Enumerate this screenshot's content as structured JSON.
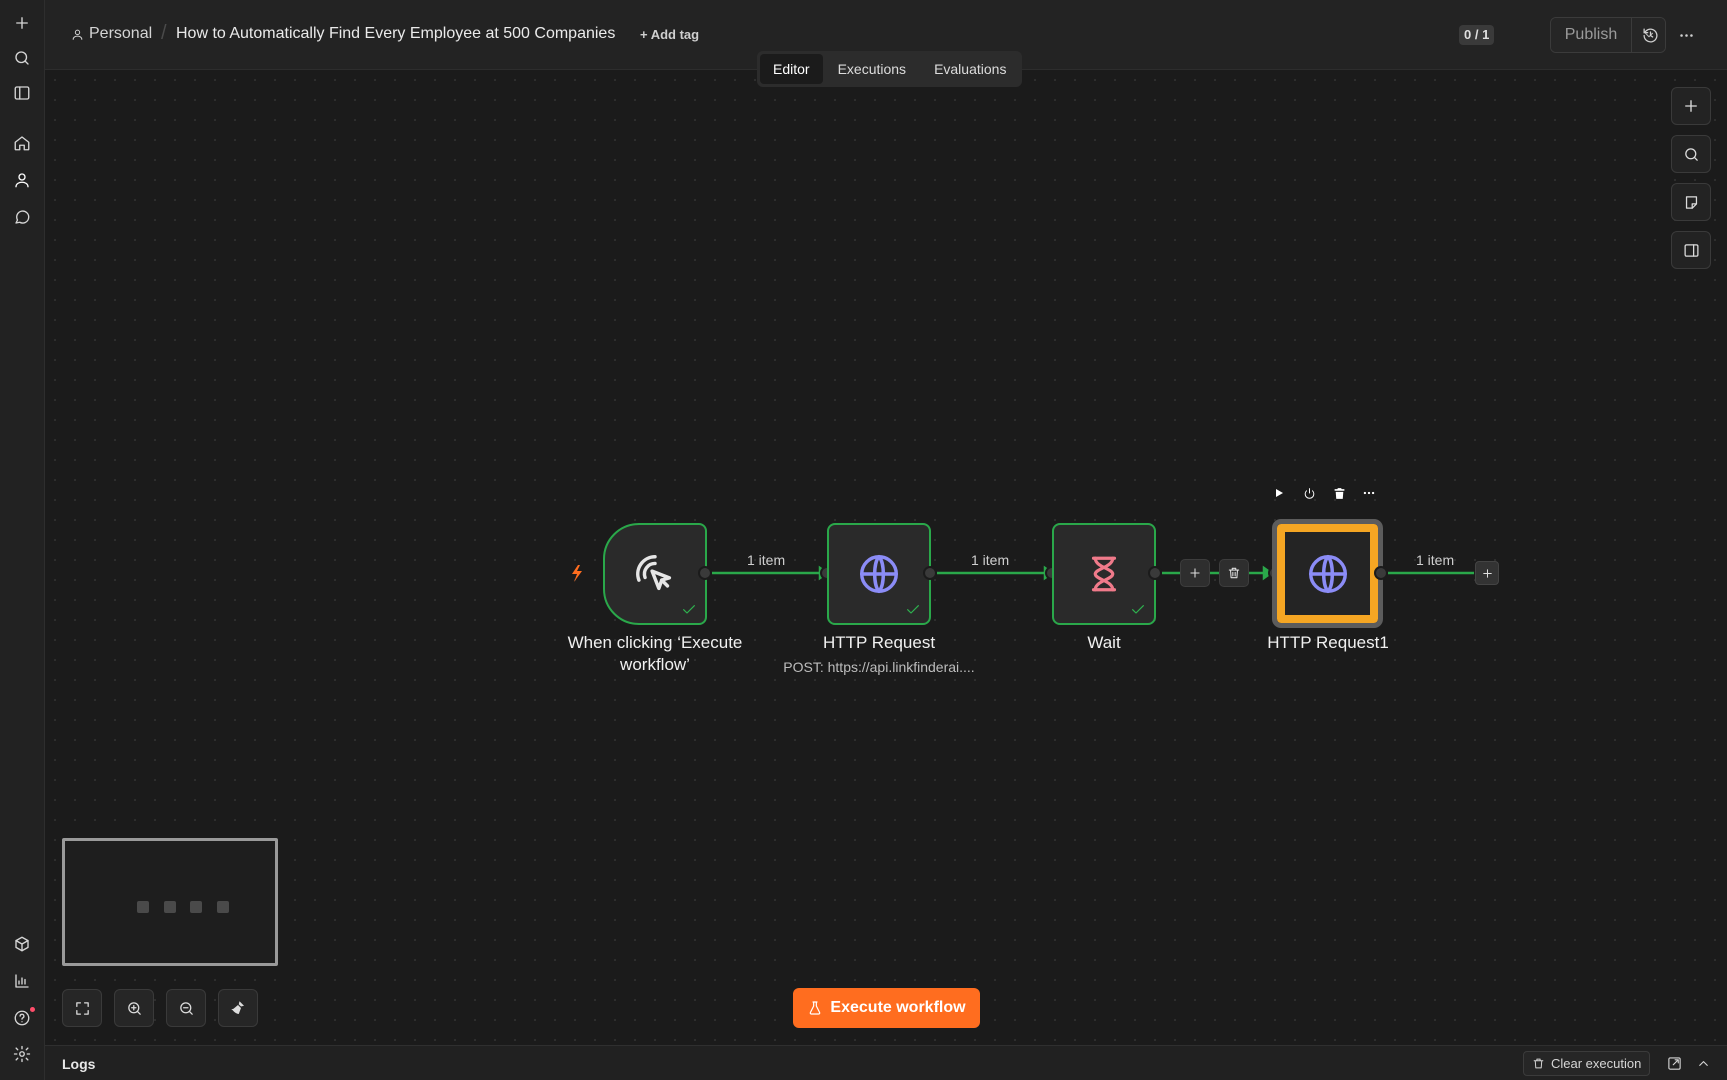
{
  "header": {
    "breadcrumb_personal": "Personal",
    "workflow_title": "How to Automatically Find Every Employee at 500 Companies",
    "add_tag": "+ Add tag",
    "counter": "0 / 1",
    "publish_label": "Publish",
    "tabs": [
      {
        "label": "Editor",
        "active": true
      },
      {
        "label": "Executions",
        "active": false
      },
      {
        "label": "Evaluations",
        "active": false
      }
    ]
  },
  "sidebar": {
    "items": [
      {
        "icon": "plus-icon"
      },
      {
        "icon": "search-icon"
      },
      {
        "icon": "panel-toggle-icon"
      },
      {
        "icon": "home-icon"
      },
      {
        "icon": "user-icon",
        "active": true
      },
      {
        "icon": "chat-icon"
      },
      {
        "icon": "templates-icon"
      },
      {
        "icon": "insights-icon"
      },
      {
        "icon": "help-icon",
        "notification": true
      },
      {
        "icon": "settings-icon"
      }
    ]
  },
  "workflow": {
    "nodes": [
      {
        "name": "When clicking ‘Execute workflow’",
        "icon": "pointer-click-icon",
        "type": "trigger",
        "status": "success"
      },
      {
        "name": "HTTP Request",
        "subtitle": "POST: https://api.linkfinderai....",
        "icon": "globe-icon",
        "status": "success"
      },
      {
        "name": "Wait",
        "icon": "hourglass-icon",
        "status": "success"
      },
      {
        "name": "HTTP Request1",
        "icon": "globe-icon",
        "selected": true
      }
    ],
    "edges": [
      {
        "label": "1 item"
      },
      {
        "label": "1 item"
      },
      {
        "label": ""
      },
      {
        "label": "1 item"
      }
    ]
  },
  "canvas": {
    "execute_button": "Execute workflow"
  },
  "logs": {
    "title": "Logs",
    "clear_execution": "Clear execution"
  },
  "colors": {
    "success": "#2aa84a",
    "accent": "#ff6d1f",
    "selected": "#f5a623",
    "globe": "#8b8cf6",
    "wait": "#f07a8a"
  }
}
